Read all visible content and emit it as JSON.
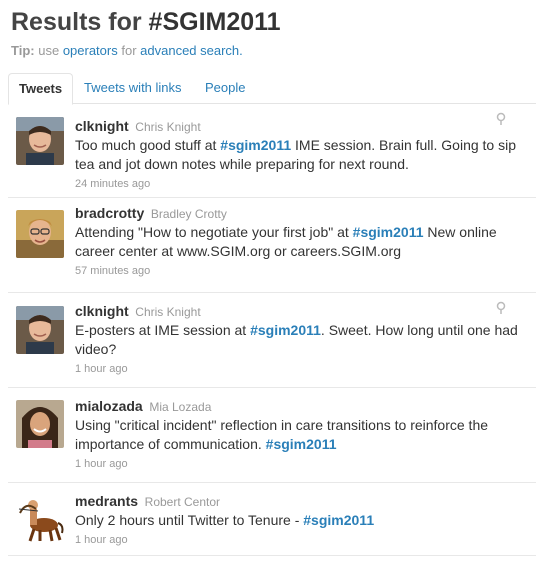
{
  "header": {
    "title_prefix": "Results for",
    "query": "#SGIM2011",
    "tip_label": "Tip:",
    "tip_text1": "use",
    "tip_link1": "operators",
    "tip_text2": "for",
    "tip_link2": "advanced search."
  },
  "tabs": [
    {
      "label": "Tweets",
      "active": true
    },
    {
      "label": "Tweets with links",
      "active": false
    },
    {
      "label": "People",
      "active": false
    }
  ],
  "tweets": [
    {
      "username": "clknight",
      "fullname": "Chris Knight",
      "text_before": "Too much good stuff at",
      "hashtag": "#sgim2011",
      "text_after": "IME session. Brain full. Going to sip tea and jot down notes while preparing for next round.",
      "time": "24 minutes ago",
      "has_location": true,
      "avatar_icon": "person-photo"
    },
    {
      "username": "bradcrotty",
      "fullname": "Bradley Crotty",
      "text_before": "Attending \"How to negotiate your first job\" at",
      "hashtag": "#sgim2011",
      "text_after": "New online career center at www.SGIM.org or careers.SGIM.org",
      "time": "57 minutes ago",
      "has_location": false,
      "avatar_icon": "person-photo"
    },
    {
      "username": "clknight",
      "fullname": "Chris Knight",
      "text_before": "E-posters at IME session at",
      "hashtag": "#sgim2011",
      "text_after": ". Sweet. How long until one had video?",
      "time": "1 hour ago",
      "has_location": true,
      "avatar_icon": "person-photo"
    },
    {
      "username": "mialozada",
      "fullname": "Mia Lozada",
      "text_before": "Using \"critical incident\" reflection in care transitions to reinforce the importance of communication.",
      "hashtag": "#sgim2011",
      "text_after": "",
      "time": "1 hour ago",
      "has_location": false,
      "avatar_icon": "person-photo"
    },
    {
      "username": "medrants",
      "fullname": "Robert Centor",
      "text_before": "Only 2 hours until Twitter to Tenure -",
      "hashtag": "#sgim2011",
      "text_after": "",
      "time": "1 hour ago",
      "has_location": false,
      "avatar_icon": "centaur-illustration"
    }
  ],
  "colors": {
    "link": "#2a7fb8",
    "muted": "#999999",
    "text": "#333333",
    "divider": "#e8e8e8"
  }
}
